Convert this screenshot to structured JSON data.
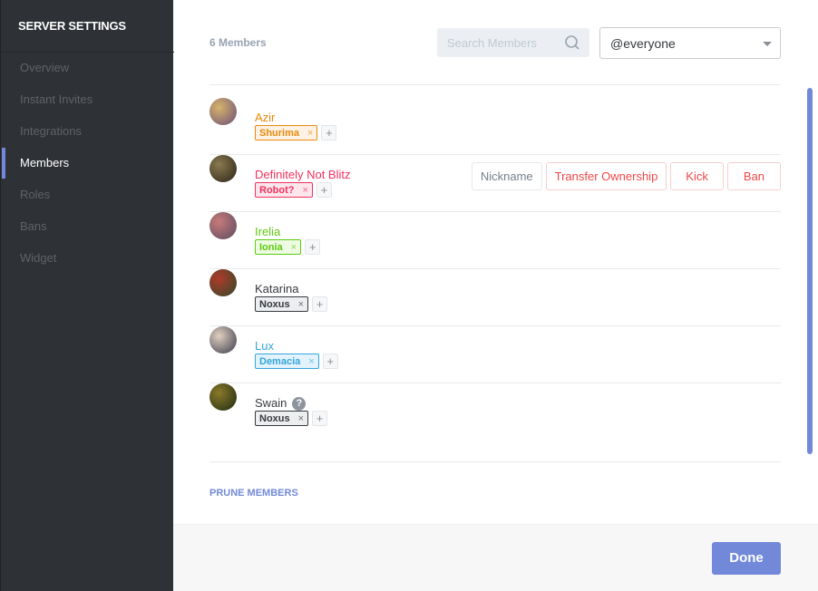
{
  "sidebar": {
    "title": "SERVER SETTINGS",
    "items": [
      {
        "label": "Overview"
      },
      {
        "label": "Instant Invites"
      },
      {
        "label": "Integrations"
      },
      {
        "label": "Members",
        "active": true
      },
      {
        "label": "Roles"
      },
      {
        "label": "Bans"
      },
      {
        "label": "Widget"
      }
    ]
  },
  "header": {
    "member_count": "6 Members",
    "search_placeholder": "Search Members",
    "role_filter": "@everyone"
  },
  "members": [
    {
      "name": "Azir",
      "color": "#e8890c",
      "role": "Shurima",
      "role_color": "#e8890c",
      "role_bg": "#fdf2e4",
      "avatar": [
        "#d7b46a",
        "#6b4e7a"
      ]
    },
    {
      "name": "Definitely Not Blitz",
      "color": "#f0325f",
      "role": "Robot?",
      "role_color": "#f0325f",
      "role_bg": "#fde6ec",
      "avatar": [
        "#8a7a50",
        "#2b2418"
      ]
    },
    {
      "name": "Irelia",
      "color": "#5ccb0e",
      "role": "Ionia",
      "role_color": "#5ccb0e",
      "role_bg": "#eefbe3",
      "avatar": [
        "#c87a7a",
        "#5a4b60"
      ]
    },
    {
      "name": "Katarina",
      "color": "#36393e",
      "role": "Noxus",
      "role_color": "#36393e",
      "role_bg": "#eceef0",
      "avatar": [
        "#b03a2a",
        "#2f4a2a"
      ]
    },
    {
      "name": "Lux",
      "color": "#33a5dc",
      "role": "Demacia",
      "role_color": "#33a5dc",
      "role_bg": "#e3f3fb",
      "avatar": [
        "#e0d0c0",
        "#3a3a4a"
      ]
    },
    {
      "name": "Swain",
      "color": "#36393e",
      "role": "Noxus",
      "role_color": "#36393e",
      "role_bg": "#eceef0",
      "avatar": [
        "#8a7a2a",
        "#1e2a10"
      ],
      "help": "?"
    }
  ],
  "actions": {
    "nickname": "Nickname",
    "transfer": "Transfer Ownership",
    "kick": "Kick",
    "ban": "Ban"
  },
  "add_symbol": "+",
  "remove_symbol": "×",
  "prune_label": "PRUNE MEMBERS",
  "done_label": "Done",
  "accent": "#7289da"
}
